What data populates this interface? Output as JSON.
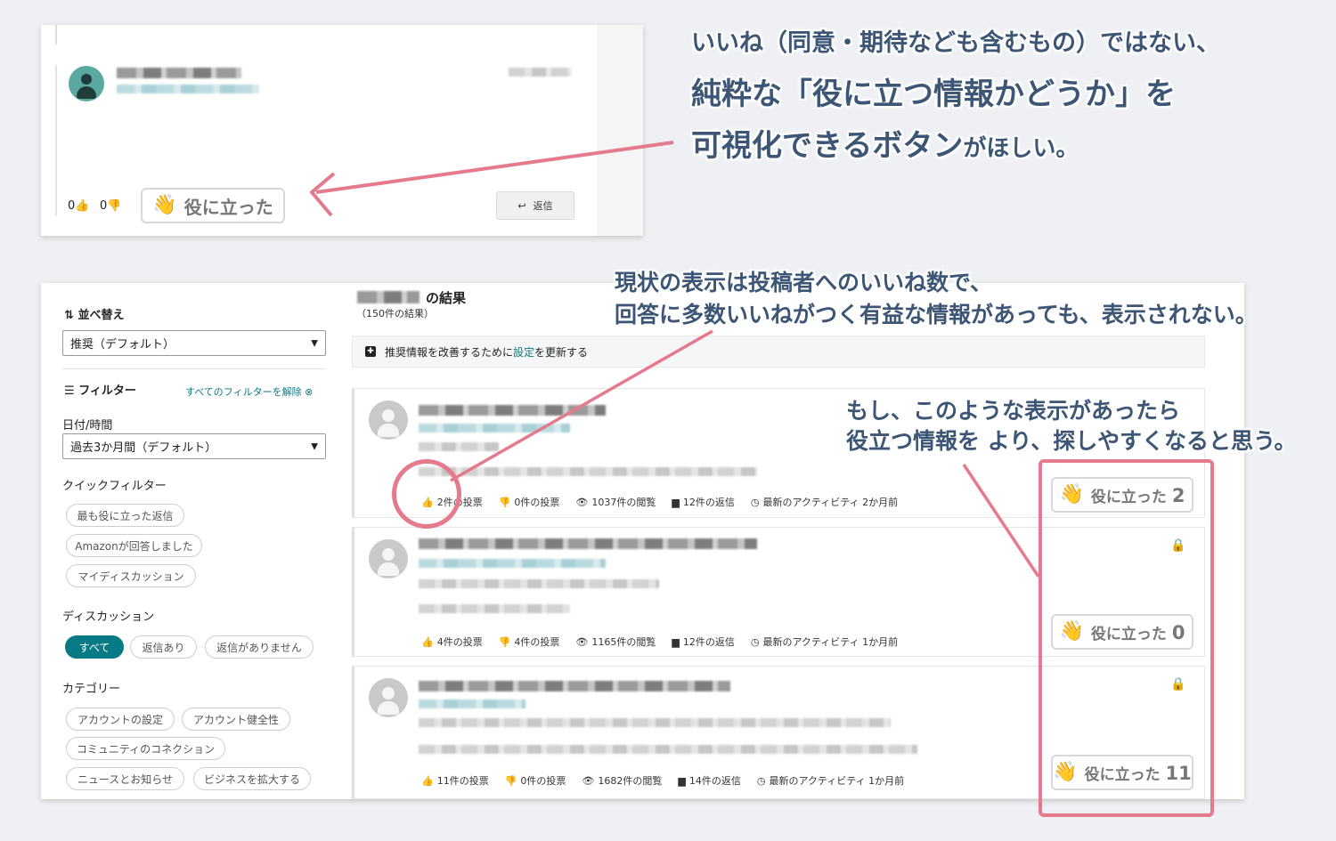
{
  "panel1": {
    "up_votes": "0",
    "down_votes": "0",
    "helpful_button_label": "役に立った",
    "reply_label": "返信"
  },
  "callout1": {
    "line1": "いいね（同意・期待なども含むもの）ではない、",
    "line2": "純粋な「役に立つ情報かどうか」を",
    "line3a": "可視化できるボタン",
    "line3b": "がほしい。"
  },
  "callout2": {
    "line1": "現状の表示は投稿者へのいいね数で、",
    "line2": "回答に多数いいねがつく有益な情報があっても、表示されない。"
  },
  "callout3": {
    "line1": "もし、このような表示があったら",
    "line2": "役立つ情報を より、探しやすくなると思う。"
  },
  "sidebar": {
    "sort_label": "並べ替え",
    "sort_value": "推奨（デフォルト）",
    "filter_label": "フィルター",
    "clear_filters": "すべてのフィルターを解除",
    "date_label": "日付/時間",
    "date_value": "過去3か月間（デフォルト）",
    "quick_filter_label": "クイックフィルター",
    "quick_filters": [
      "最も役に立った返信",
      "Amazonが回答しました",
      "マイディスカッション"
    ],
    "discussion_label": "ディスカッション",
    "discussion_filters": [
      "すべて",
      "返信あり",
      "返信がありません"
    ],
    "category_label": "カテゴリー",
    "categories": [
      "アカウントの設定",
      "アカウント健全性",
      "コミュニティのコネクション",
      "ニュースとお知らせ",
      "ビジネスを拡大する"
    ]
  },
  "results": {
    "title_suffix": "の結果",
    "count": "（150件の結果）",
    "banner_prefix": "推奨情報を改善するために",
    "banner_link": "設定",
    "banner_suffix": "を更新する"
  },
  "posts": [
    {
      "up": "2件の投票",
      "down": "0件の投票",
      "views": "1037件の閲覧",
      "replies": "12件の返信",
      "activity": "最新のアクティビティ 2か月前",
      "helpful": "役に立った",
      "helpful_count": "2"
    },
    {
      "up": "4件の投票",
      "down": "4件の投票",
      "views": "1165件の閲覧",
      "replies": "12件の返信",
      "activity": "最新のアクティビティ 1か月前",
      "helpful": "役に立った",
      "helpful_count": "0"
    },
    {
      "up": "11件の投票",
      "down": "0件の投票",
      "views": "1682件の閲覧",
      "replies": "14件の返信",
      "activity": "最新のアクティビティ 1か月前",
      "helpful": "役に立った",
      "helpful_count": "11"
    }
  ],
  "colors": {
    "accent_teal": "#087a85",
    "annotation_pink": "#e57a8d",
    "callout_text": "#3d5675"
  }
}
